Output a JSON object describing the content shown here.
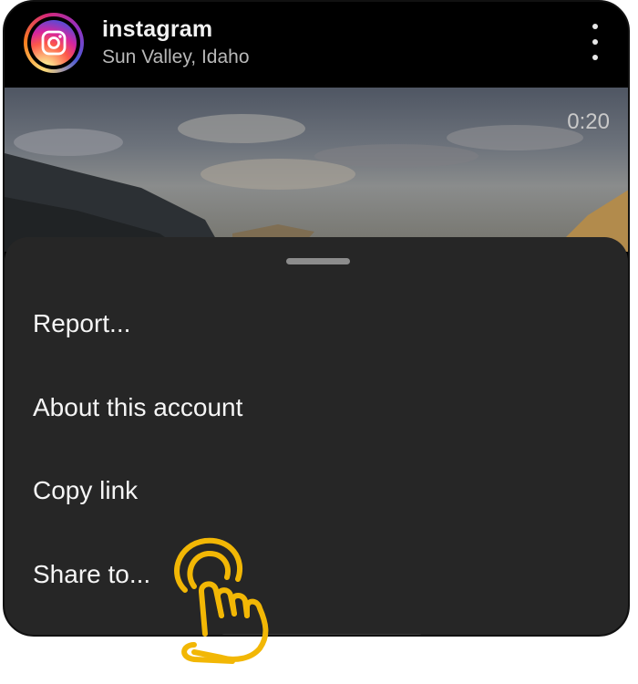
{
  "header": {
    "username": "instagram",
    "location": "Sun Valley, Idaho",
    "avatar_icon": "instagram-logo-icon",
    "more_icon": "more-vertical-icon"
  },
  "video": {
    "timer": "0:20"
  },
  "sheet": {
    "items": [
      {
        "label": "Report..."
      },
      {
        "label": "About this account"
      },
      {
        "label": "Copy link"
      },
      {
        "label": "Share to..."
      }
    ]
  },
  "overlay": {
    "cursor_icon": "tap-hand-icon",
    "cursor_color": "#F2B705"
  }
}
